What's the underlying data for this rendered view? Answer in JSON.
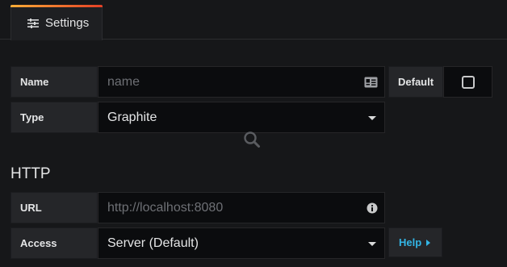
{
  "tabs": [
    {
      "label": "Settings",
      "icon": "sliders-icon",
      "active": true
    }
  ],
  "form": {
    "name": {
      "label": "Name",
      "placeholder": "name",
      "value": ""
    },
    "default": {
      "label": "Default",
      "checked": false
    },
    "type": {
      "label": "Type",
      "value": "Graphite"
    }
  },
  "http": {
    "title": "HTTP",
    "url": {
      "label": "URL",
      "placeholder": "http://localhost:8080",
      "value": ""
    },
    "access": {
      "label": "Access",
      "value": "Server (Default)"
    },
    "help_label": "Help"
  },
  "colors": {
    "accent_gradient_start": "#fbad37",
    "accent_gradient_end": "#e54026",
    "link": "#33b5e5",
    "background": "#161719"
  }
}
